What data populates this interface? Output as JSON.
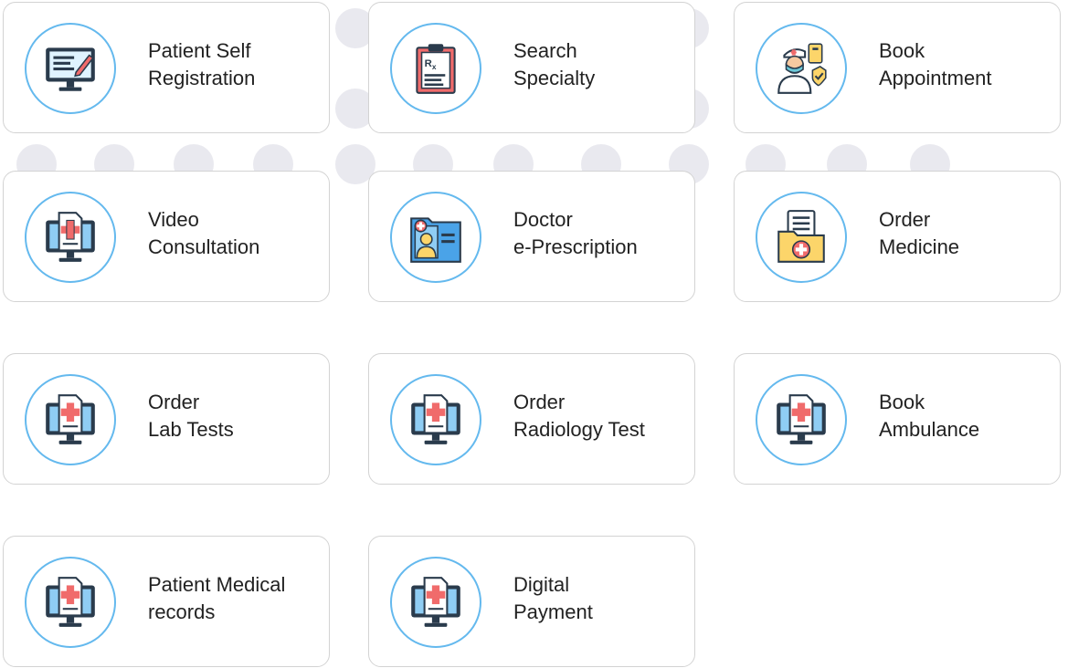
{
  "colors": {
    "ring": "#64b9ee",
    "card_border": "#d3d3d3",
    "text": "#222222",
    "background_dots": "#e9e9ef"
  },
  "cards": [
    {
      "line1": "Patient Self",
      "line2": "Registration",
      "icon": "computer-edit-icon"
    },
    {
      "line1": "Search",
      "line2": "Specialty",
      "icon": "prescription-clipboard-icon"
    },
    {
      "line1": "Book",
      "line2": "Appointment",
      "icon": "nurse-icon"
    },
    {
      "line1": "Video",
      "line2": "Consultation",
      "icon": "medical-monitor-icon"
    },
    {
      "line1": "Doctor",
      "line2": "e-Prescription",
      "icon": "patient-file-icon"
    },
    {
      "line1": "Order",
      "line2": "Medicine",
      "icon": "medical-folder-icon"
    },
    {
      "line1": "Order",
      "line2": "Lab Tests",
      "icon": "medical-monitor-icon"
    },
    {
      "line1": "Order",
      "line2": "Radiology Test",
      "icon": "medical-monitor-icon"
    },
    {
      "line1": "Book",
      "line2": "Ambulance",
      "icon": "medical-monitor-icon"
    },
    {
      "line1": "Patient Medical",
      "line2": "records",
      "icon": "medical-monitor-icon"
    },
    {
      "line1": "Digital",
      "line2": "Payment",
      "icon": "medical-monitor-icon"
    }
  ]
}
